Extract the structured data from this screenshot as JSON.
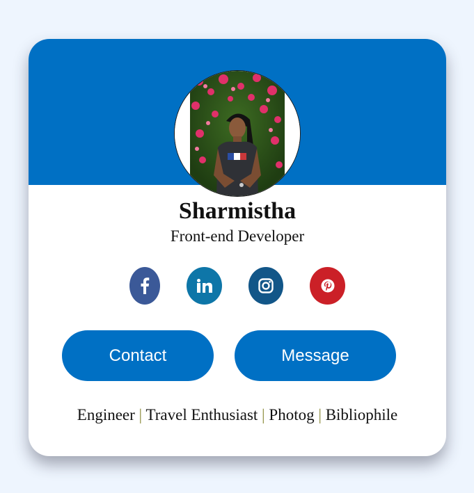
{
  "profile": {
    "name": "Sharmistha",
    "role": "Front-end Developer"
  },
  "social": [
    {
      "label": "f",
      "icon": "facebook-icon",
      "color": "#3b5998"
    },
    {
      "label": "in",
      "icon": "linkedin-icon",
      "color": "#0e76a8"
    },
    {
      "label": "instagram",
      "icon": "instagram-icon",
      "color": "#125688"
    },
    {
      "label": "P",
      "icon": "pinterest-icon",
      "color": "#cb2027"
    }
  ],
  "actions": {
    "contact_label": "Contact",
    "message_label": "Message"
  },
  "tags": {
    "items": [
      "Engineer",
      "Travel Enthusiast",
      "Photog",
      "Bibliophile"
    ],
    "separator": "|"
  },
  "colors": {
    "accent": "#0070c4",
    "background": "#eef5fe",
    "card": "#ffffff"
  }
}
